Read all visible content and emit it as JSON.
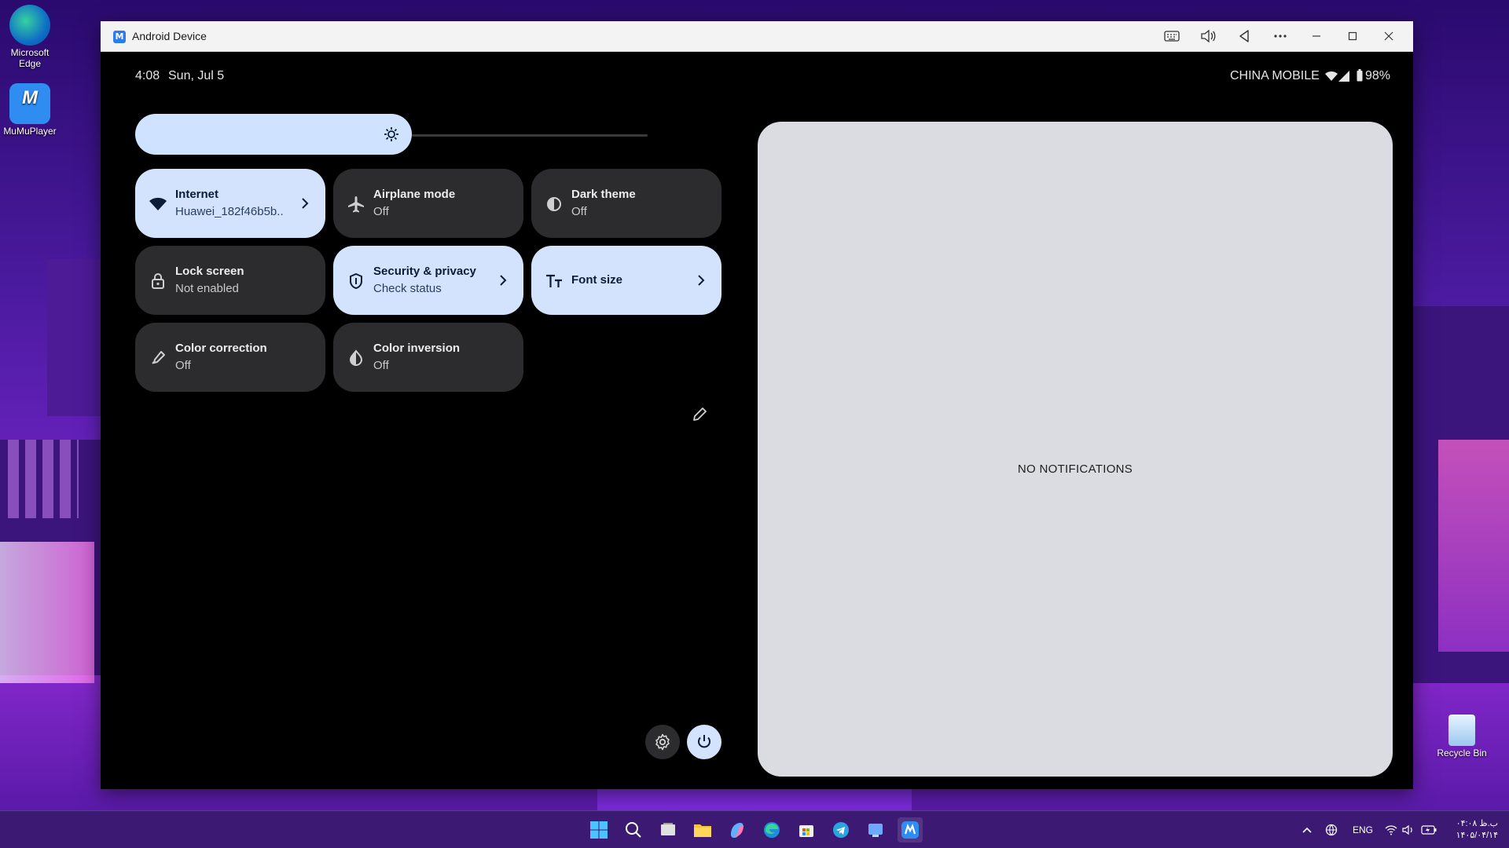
{
  "desktop": {
    "icons": [
      {
        "label_line1": "Microsoft",
        "label_line2": "Edge",
        "icon": "edge-icon"
      },
      {
        "label_line1": "MuMuPlayer",
        "label_line2": "",
        "icon": "mumu-icon"
      },
      {
        "label_line1": "Recycle Bin",
        "label_line2": "",
        "icon": "recycle-bin-icon"
      }
    ]
  },
  "window": {
    "title": "Android Device",
    "toolbar_icons": [
      "keyboard-icon",
      "volume-icon",
      "back-icon",
      "more-icon",
      "minimize-icon",
      "maximize-icon",
      "close-icon"
    ]
  },
  "android": {
    "status": {
      "time": "4:08",
      "date": "Sun, Jul 5",
      "carrier": "CHINA MOBILE",
      "battery": "98%"
    },
    "brightness": {
      "level": 0.4,
      "icon": "brightness-icon"
    },
    "tiles": [
      {
        "title": "Internet",
        "subtitle": "Huawei_182f46b5b..",
        "icon": "wifi-icon",
        "active": true,
        "chevron": true
      },
      {
        "title": "Airplane mode",
        "subtitle": "Off",
        "icon": "airplane-icon",
        "active": false,
        "chevron": false
      },
      {
        "title": "Dark theme",
        "subtitle": "Off",
        "icon": "dark-theme-icon",
        "active": false,
        "chevron": false
      },
      {
        "title": "Lock screen",
        "subtitle": "Not enabled",
        "icon": "lock-icon",
        "active": false,
        "chevron": false
      },
      {
        "title": "Security & privacy",
        "subtitle": "Check status",
        "icon": "shield-icon",
        "active": true,
        "chevron": true
      },
      {
        "title": "Font size",
        "subtitle": "",
        "icon": "font-size-icon",
        "active": true,
        "chevron": true
      },
      {
        "title": "Color correction",
        "subtitle": "Off",
        "icon": "color-correction-icon",
        "active": false,
        "chevron": false
      },
      {
        "title": "Color inversion",
        "subtitle": "Off",
        "icon": "color-inversion-icon",
        "active": false,
        "chevron": false
      }
    ],
    "notifications": {
      "empty_text": "NO NOTIFICATIONS"
    }
  },
  "taskbar": {
    "apps": [
      "start-icon",
      "search-icon",
      "task-view-icon",
      "file-explorer-icon",
      "copilot-icon",
      "edge-icon",
      "store-icon",
      "telegram-icon",
      "app-icon",
      "mumu-icon"
    ],
    "tray": {
      "language": "ENG",
      "time": "ب.ظ ۰۴:۰۸",
      "date": "۱۴۰۵/۰۴/۱۴"
    }
  },
  "colors": {
    "tile_active": "#d3e3fd",
    "tile_inactive": "#2c2c2e",
    "notif_panel": "#dadce2",
    "taskbar": "#3c1a73"
  }
}
